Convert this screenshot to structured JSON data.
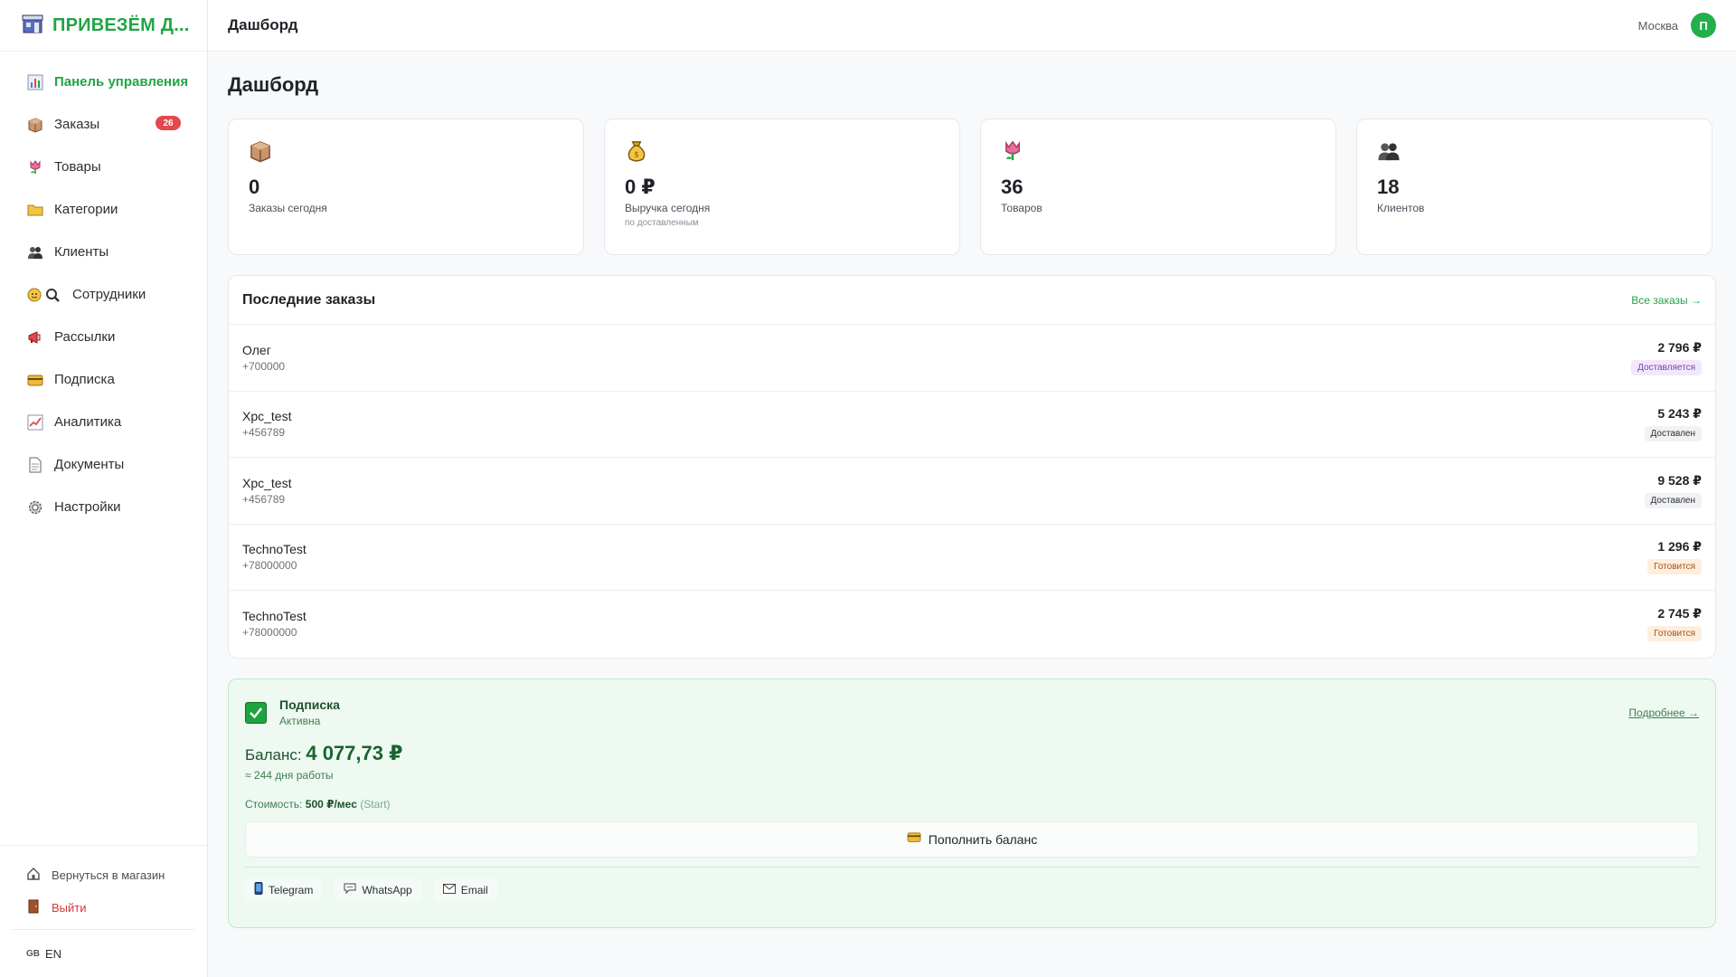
{
  "brand": {
    "name": "ПРИВЕЗЁМ Д...",
    "icon": "storefront-icon"
  },
  "sidebar": {
    "items": [
      {
        "label": "Панель управления",
        "icon": "chart-icon",
        "active": true
      },
      {
        "label": "Заказы",
        "icon": "box-icon",
        "badge": "26"
      },
      {
        "label": "Товары",
        "icon": "tulip-icon"
      },
      {
        "label": "Категории",
        "icon": "folder-icon"
      },
      {
        "label": "Клиенты",
        "icon": "users-icon"
      },
      {
        "label": "Сотрудники",
        "icon": "staff-icon"
      },
      {
        "label": "Рассылки",
        "icon": "megaphone-icon"
      },
      {
        "label": "Подписка",
        "icon": "card-icon"
      },
      {
        "label": "Аналитика",
        "icon": "trend-icon"
      },
      {
        "label": "Документы",
        "icon": "document-icon"
      },
      {
        "label": "Настройки",
        "icon": "gear-icon"
      }
    ],
    "back_to_store": "Вернуться в магазин",
    "logout": "Выйти",
    "lang_flag": "GB",
    "lang": "EN"
  },
  "topbar": {
    "title": "Дашборд",
    "city": "Москва",
    "avatar": "П"
  },
  "page": {
    "title": "Дашборд"
  },
  "stats": [
    {
      "value": "0",
      "label": "Заказы сегодня",
      "sub": "",
      "icon": "box-icon"
    },
    {
      "value": "0 ₽",
      "label": "Выручка сегодня",
      "sub": "по доставленным",
      "icon": "money-bag-icon"
    },
    {
      "value": "36",
      "label": "Товаров",
      "sub": "",
      "icon": "tulip-icon"
    },
    {
      "value": "18",
      "label": "Клиентов",
      "sub": "",
      "icon": "users-icon"
    }
  ],
  "orders": {
    "title": "Последние заказы",
    "all_link": "Все заказы →",
    "rows": [
      {
        "name": "Олег",
        "phone": "+700000",
        "sum": "2 796 ₽",
        "status": "Доставляется",
        "status_bg": "#f3e8fb",
        "status_color": "#7b3fa8"
      },
      {
        "name": "Xpc_test",
        "phone": "+456789",
        "sum": "5 243 ₽",
        "status": "Доставлен",
        "status_bg": "#f1f2f4",
        "status_color": "#2b2f33"
      },
      {
        "name": "Xpc_test",
        "phone": "+456789",
        "sum": "9 528 ₽",
        "status": "Доставлен",
        "status_bg": "#f1f2f4",
        "status_color": "#2b2f33"
      },
      {
        "name": "TechnoTest",
        "phone": "+78000000",
        "sum": "1 296 ₽",
        "status": "Готовится",
        "status_bg": "#fdeedd",
        "status_color": "#a5541a"
      },
      {
        "name": "TechnoTest",
        "phone": "+78000000",
        "sum": "2 745 ₽",
        "status": "Готовится",
        "status_bg": "#fdeedd",
        "status_color": "#a5541a"
      }
    ]
  },
  "subscription": {
    "title": "Подписка",
    "status": "Активна",
    "more": "Подробнее →",
    "balance_label": "Баланс:",
    "balance": "4 077,73 ₽",
    "days": "≈ 244 дня работы",
    "cost_label": "Стоимость:",
    "cost": "500 ₽/мес",
    "plan": "(Start)",
    "topup": "Пополнить баланс",
    "contacts": [
      {
        "label": "Telegram",
        "icon": "phone-icon"
      },
      {
        "label": "WhatsApp",
        "icon": "chat-icon"
      },
      {
        "label": "Email",
        "icon": "mail-icon"
      }
    ]
  },
  "colors": {
    "accent": "#22a447",
    "danger": "#e5484d"
  }
}
